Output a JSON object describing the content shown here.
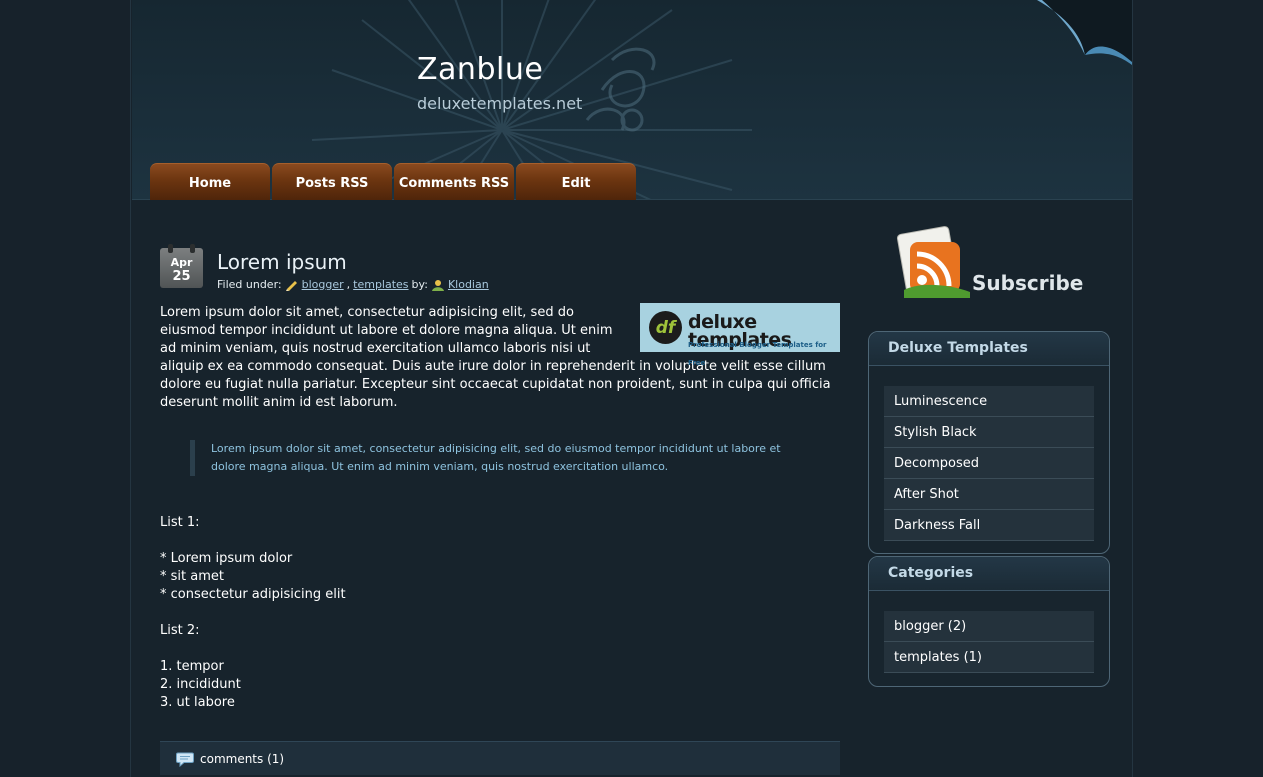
{
  "site": {
    "title": "Zanblue",
    "subtitle": "deluxetemplates.net"
  },
  "nav": [
    "Home",
    "Posts RSS",
    "Comments RSS",
    "Edit"
  ],
  "post": {
    "date_month": "Apr",
    "date_day": "25",
    "title": "Lorem ipsum",
    "meta_prefix": "Filed under:",
    "categories": [
      "blogger",
      "templates"
    ],
    "by_label": "by:",
    "author": "Klodian",
    "logo": {
      "mark": "df",
      "word": "deluxe templates",
      "tagline": "Professional Blogger Templates for Free"
    },
    "paragraph": "Lorem ipsum dolor sit amet, consectetur adipisicing elit, sed do eiusmod tempor incididunt ut labore et dolore magna aliqua. Ut enim ad minim veniam, quis nostrud exercitation ullamco laboris nisi ut aliquip ex ea commodo consequat. Duis aute irure dolor in reprehenderit in voluptate velit esse cillum dolore eu fugiat nulla pariatur. Excepteur sint occaecat cupidatat non proident, sunt in culpa qui officia deserunt mollit anim id est laborum.",
    "quote": "Lorem ipsum dolor sit amet, consectetur adipisicing elit, sed do eiusmod tempor incididunt ut labore et dolore magna aliqua. Ut enim ad minim veniam, quis nostrud exercitation ullamco.",
    "list1_label": "List 1:",
    "list1": [
      "* Lorem ipsum dolor",
      "* sit amet",
      "* consectetur adipisicing elit"
    ],
    "list2_label": "List 2:",
    "list2": [
      "1. tempor",
      "2. incididunt",
      "3. ut labore"
    ],
    "comments_label": "comments (1)"
  },
  "sidebar": {
    "subscribe_label": "Subscribe",
    "widgets": [
      {
        "title": "Deluxe Templates",
        "items": [
          "Luminescence",
          "Stylish Black",
          "Decomposed",
          "After Shot",
          "Darkness Fall"
        ]
      },
      {
        "title": "Categories",
        "items": [
          "blogger (2)",
          "templates (1)"
        ]
      }
    ]
  },
  "colors": {
    "background": "#17232c",
    "tab": "#6c3510",
    "link": "#a9c8dd",
    "quote_text": "#8ec3df"
  },
  "icons": [
    "pencil-icon",
    "user-icon",
    "comment-bubble-icon",
    "rss-icon",
    "calendar-icon",
    "page-curl-icon"
  ]
}
